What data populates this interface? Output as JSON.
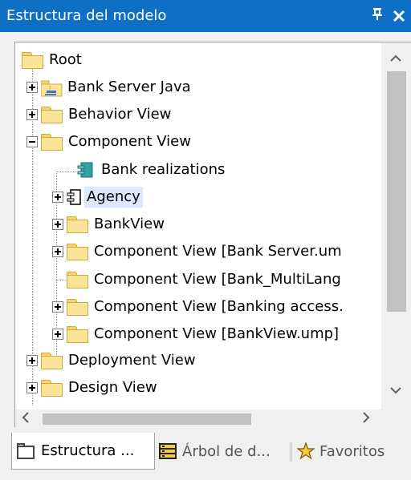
{
  "window": {
    "title": "Estructura del modelo",
    "pin_glyph": "ᵖ",
    "close_glyph": "✕"
  },
  "tree": {
    "root": {
      "label": "Root"
    },
    "items": [
      {
        "label": "Bank Server Java",
        "icon": "java-package-icon",
        "expander": "plus"
      },
      {
        "label": "Behavior View",
        "icon": "folder-icon",
        "expander": "plus"
      },
      {
        "label": "Component View",
        "icon": "folder-icon",
        "expander": "minus"
      },
      {
        "label": "Bank realizations",
        "icon": "component-diagram-icon",
        "expander": "none"
      },
      {
        "label": "Agency",
        "icon": "component-icon",
        "expander": "plus",
        "selected": true
      },
      {
        "label": "BankView",
        "icon": "folder-icon",
        "expander": "plus"
      },
      {
        "label": "Component View [Bank Server.um",
        "icon": "folder-icon",
        "expander": "plus"
      },
      {
        "label": "Component View [Bank_MultiLang",
        "icon": "folder-icon",
        "expander": "none"
      },
      {
        "label": "Component View [Banking access.",
        "icon": "folder-icon",
        "expander": "plus"
      },
      {
        "label": "Component View [BankView.ump]",
        "icon": "folder-icon",
        "expander": "plus"
      },
      {
        "label": "Deployment View",
        "icon": "folder-icon",
        "expander": "plus"
      },
      {
        "label": "Design View",
        "icon": "folder-icon",
        "expander": "plus"
      }
    ]
  },
  "scrollbars": {
    "up": "^",
    "down": "v",
    "left": "<",
    "right": ">"
  },
  "tabs": [
    {
      "label": "Estructura ...",
      "icon": "folder-icon",
      "active": true
    },
    {
      "label": "Árbol de d...",
      "icon": "diagram-tree-icon",
      "active": false
    },
    {
      "label": "Favoritos",
      "icon": "star-icon",
      "active": false
    }
  ],
  "colors": {
    "titlebar": "#0e6fc5",
    "selection": "#dde8ff",
    "folder": "#fbe39a"
  }
}
